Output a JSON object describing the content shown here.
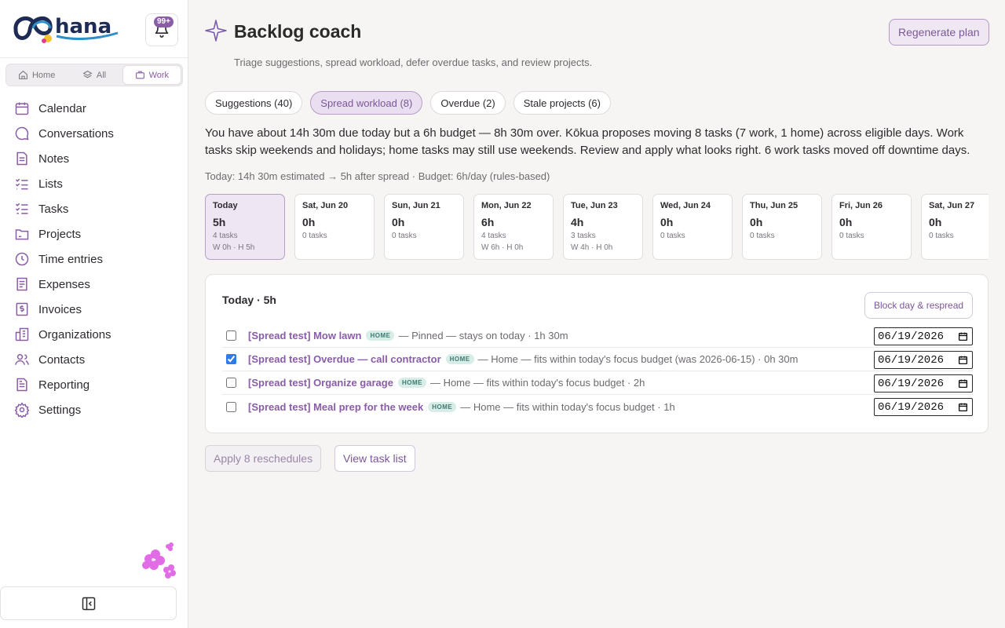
{
  "sidebar": {
    "notifications_badge": "99+",
    "scope": [
      {
        "label": "Home",
        "icon": "home-icon"
      },
      {
        "label": "All",
        "icon": "layers-icon"
      },
      {
        "label": "Work",
        "icon": "briefcase-icon",
        "active": true
      }
    ],
    "nav": [
      {
        "label": "Calendar",
        "icon": "calendar-icon"
      },
      {
        "label": "Conversations",
        "icon": "chat-icon"
      },
      {
        "label": "Notes",
        "icon": "note-icon"
      },
      {
        "label": "Lists",
        "icon": "list-icon"
      },
      {
        "label": "Tasks",
        "icon": "tasks-icon"
      },
      {
        "label": "Projects",
        "icon": "folder-icon"
      },
      {
        "label": "Time entries",
        "icon": "clock-icon"
      },
      {
        "label": "Expenses",
        "icon": "receipt-icon"
      },
      {
        "label": "Invoices",
        "icon": "dollar-icon"
      },
      {
        "label": "Organizations",
        "icon": "building-icon"
      },
      {
        "label": "Contacts",
        "icon": "people-icon"
      },
      {
        "label": "Reporting",
        "icon": "report-icon"
      },
      {
        "label": "Settings",
        "icon": "gear-icon"
      }
    ]
  },
  "header": {
    "title": "Backlog coach",
    "subtitle": "Triage suggestions, spread workload, defer overdue tasks, and review projects.",
    "regenerate_label": "Regenerate plan"
  },
  "tabs": [
    {
      "label": "Suggestions (40)"
    },
    {
      "label": "Spread workload (8)",
      "active": true
    },
    {
      "label": "Overdue (2)"
    },
    {
      "label": "Stale projects (6)"
    }
  ],
  "summary": "You have about 14h 30m due today but a 6h budget — 8h 30m over. Kōkua proposes moving 8 tasks (7 work, 1 home) across eligible days. Work tasks skip weekends and holidays; home tasks may still use weekends. Review and apply what looks right. 6 work tasks moved off downtime days.",
  "estimate": "Today: 14h 30m estimated → 5h after spread · Budget: 6h/day (rules-based)",
  "days": [
    {
      "name": "Today",
      "hours": "5h",
      "tasks": "4 tasks",
      "split": "W 0h · H 5h",
      "active": true
    },
    {
      "name": "Sat, Jun 20",
      "hours": "0h",
      "tasks": "0 tasks",
      "split": ""
    },
    {
      "name": "Sun, Jun 21",
      "hours": "0h",
      "tasks": "0 tasks",
      "split": ""
    },
    {
      "name": "Mon, Jun 22",
      "hours": "6h",
      "tasks": "4 tasks",
      "split": "W 6h · H 0h"
    },
    {
      "name": "Tue, Jun 23",
      "hours": "4h",
      "tasks": "3 tasks",
      "split": "W 4h · H 0h"
    },
    {
      "name": "Wed, Jun 24",
      "hours": "0h",
      "tasks": "0 tasks",
      "split": ""
    },
    {
      "name": "Thu, Jun 25",
      "hours": "0h",
      "tasks": "0 tasks",
      "split": ""
    },
    {
      "name": "Fri, Jun 26",
      "hours": "0h",
      "tasks": "0 tasks",
      "split": ""
    },
    {
      "name": "Sat, Jun 27",
      "hours": "0h",
      "tasks": "0 tasks",
      "split": ""
    }
  ],
  "panel": {
    "title": "Today · 5h",
    "block_label": "Block day & respread",
    "tasks": [
      {
        "title": "[Spread test] Mow lawn",
        "tag": "HOME",
        "note": "— Pinned — stays on today · 1h 30m",
        "date": "06/19/2026",
        "checked": false
      },
      {
        "title": "[Spread test] Overdue — call contractor",
        "tag": "HOME",
        "note": "— Home — fits within today's focus budget (was 2026-06-15) · 0h 30m",
        "date": "06/19/2026",
        "checked": true
      },
      {
        "title": "[Spread test] Organize garage",
        "tag": "HOME",
        "note": "— Home — fits within today's focus budget · 2h",
        "date": "06/19/2026",
        "checked": false
      },
      {
        "title": "[Spread test] Meal prep for the week",
        "tag": "HOME",
        "note": "— Home — fits within today's focus budget · 1h",
        "date": "06/19/2026",
        "checked": false
      }
    ]
  },
  "actions": {
    "apply_label": "Apply 8 reschedules",
    "view_label": "View task list"
  },
  "colors": {
    "accent": "#8a5ca8",
    "tag_bg": "#d8ece8",
    "background": "#f7f5f3"
  }
}
